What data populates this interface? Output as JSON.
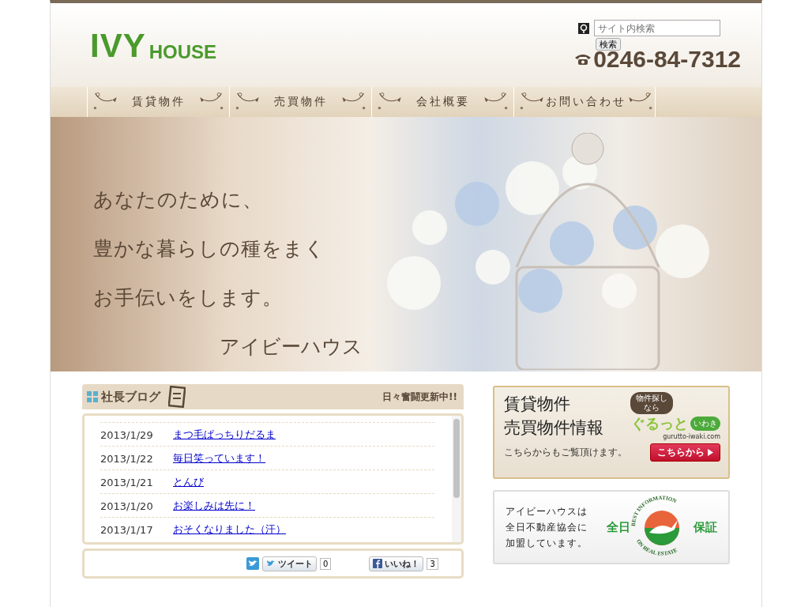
{
  "header": {
    "logo": {
      "main": "IVY",
      "sub": "HOUSE"
    },
    "search": {
      "placeholder": "サイト内検索",
      "button": "検索"
    },
    "phone": "0246-84-7312"
  },
  "nav": [
    {
      "label": "賃貸物件"
    },
    {
      "label": "売買物件"
    },
    {
      "label": "会社概要"
    },
    {
      "label": "お問い合わせ"
    }
  ],
  "hero": {
    "lines": [
      "あなたのために、",
      "豊かな暮らしの種をまく",
      "お手伝いをします。"
    ],
    "signature": "アイビーハウス"
  },
  "blog": {
    "title": "社長ブログ",
    "tagline": "日々奮闘更新中!!",
    "entries": [
      {
        "date": "2013/1/29",
        "title": "まつ毛ぱっちりだるま"
      },
      {
        "date": "2013/1/22",
        "title": "毎日笑っています！"
      },
      {
        "date": "2013/1/21",
        "title": "とんび"
      },
      {
        "date": "2013/1/20",
        "title": "お楽しみは先に！"
      },
      {
        "date": "2013/1/17",
        "title": "おそくなりました（汗）"
      }
    ],
    "social": {
      "tweet": "ツイート",
      "tweet_count": "0",
      "like": "いいね！",
      "like_count": "3"
    }
  },
  "property_banner": {
    "lines": [
      "賃貸物件",
      "売買物件情報"
    ],
    "bubble": [
      "物件探し",
      "なら"
    ],
    "brand": "ぐるっと",
    "brand_sub": "いわき",
    "url": "gurutto-iwaki.com",
    "note": "こちらからもご覧頂けます。",
    "button": "こちらから"
  },
  "association_banner": {
    "lines": [
      "アイビーハウスは",
      "全日不動産協会に",
      "加盟しています。"
    ],
    "emblem": {
      "top": "BEST INFORMATION",
      "bottom": "ON REAL ESTATE",
      "left": "全日",
      "right": "保証"
    }
  }
}
